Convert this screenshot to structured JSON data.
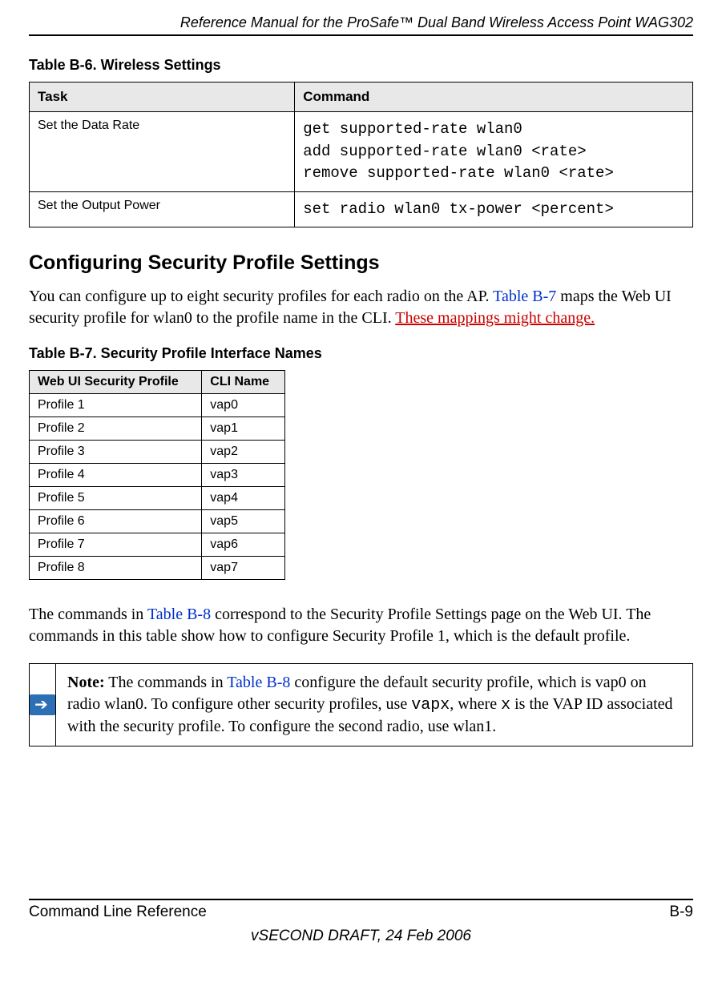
{
  "running_head": "Reference Manual for the ProSafe™ Dual Band Wireless Access Point WAG302",
  "table6": {
    "caption": "Table B-6. Wireless Settings",
    "headers": {
      "task": "Task",
      "command": "Command"
    },
    "rows": [
      {
        "task": "Set the Data Rate",
        "command": "get supported-rate wlan0\nadd supported-rate wlan0 <rate>\nremove supported-rate wlan0 <rate>"
      },
      {
        "task": "Set the Output Power",
        "command": "set radio wlan0 tx-power <percent>"
      }
    ]
  },
  "section_heading": "Configuring Security Profile Settings",
  "para1_a": "You can configure up to eight security profiles for each radio on the AP. ",
  "para1_link": "Table B-7",
  "para1_b": " maps the Web UI security profile for wlan0 to the profile name in the CLI. ",
  "para1_rev": "These mappings might change.",
  "table7": {
    "caption": "Table B-7. Security Profile Interface Names",
    "headers": {
      "profile": "Web UI Security Profile",
      "cli": "CLI Name"
    },
    "rows": [
      {
        "profile": "Profile 1",
        "cli": "vap0"
      },
      {
        "profile": "Profile 2",
        "cli": "vap1"
      },
      {
        "profile": "Profile 3",
        "cli": "vap2"
      },
      {
        "profile": "Profile 4",
        "cli": "vap3"
      },
      {
        "profile": "Profile 5",
        "cli": "vap4"
      },
      {
        "profile": "Profile 6",
        "cli": "vap5"
      },
      {
        "profile": "Profile 7",
        "cli": "vap6"
      },
      {
        "profile": "Profile 8",
        "cli": "vap7"
      }
    ]
  },
  "para2_a": "The commands in ",
  "para2_link": "Table B-8",
  "para2_b": " correspond to the Security Profile Settings page on the Web UI. The commands in this table show how to configure Security Profile 1, which is the default profile.",
  "note": {
    "label": "Note:",
    "a": " The commands in ",
    "link": "Table B-8",
    "b": " configure the default security profile, which is vap0 on radio wlan0. To configure other security profiles, use ",
    "code1": "vapx",
    "c": ", where ",
    "code2": "x",
    "d": " is the VAP ID associated with the security profile. To configure the second radio, use wlan1."
  },
  "footer": {
    "left": "Command Line Reference",
    "right": "B-9",
    "draft": "vSECOND DRAFT, 24 Feb 2006"
  }
}
